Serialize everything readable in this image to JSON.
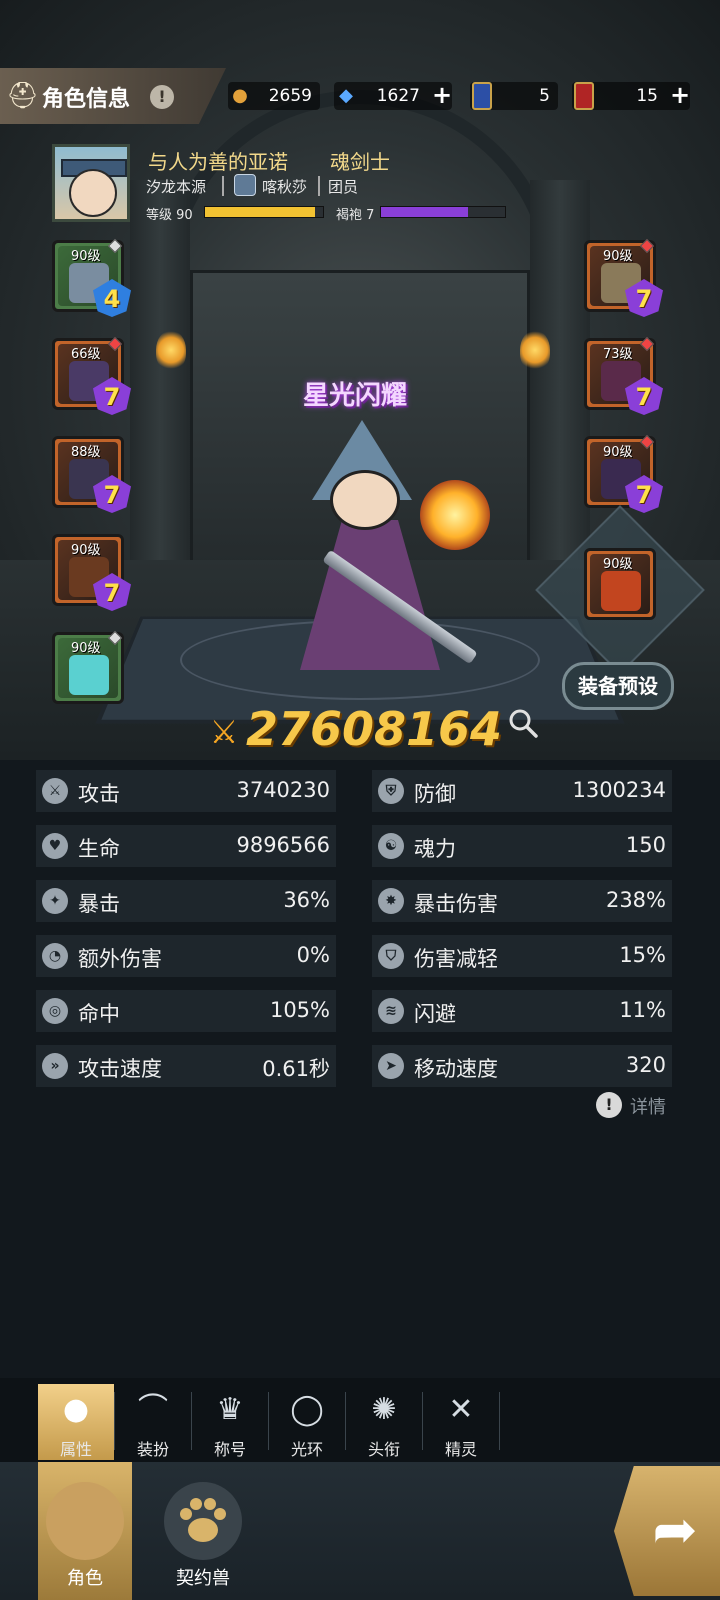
{
  "header": {
    "title": "角色信息",
    "title_icon": "helmet-icon",
    "info_icon": "exclamation-icon",
    "currencies": [
      {
        "name": "coin",
        "icon": "gold-coin-icon",
        "value": "2659",
        "plus": false
      },
      {
        "name": "crystal",
        "icon": "blue-crystal-icon",
        "value": "1627",
        "plus": true
      },
      {
        "name": "ticket-blue",
        "icon": "blue-card-icon",
        "value": "5",
        "plus": false
      },
      {
        "name": "ticket-red",
        "icon": "red-card-icon",
        "value": "15",
        "plus": true
      }
    ],
    "plus_glyph": "+"
  },
  "profile": {
    "name": "与人为善的亚诺",
    "class": "魂剑士",
    "server": "汐龙本源",
    "guild": "喀秋莎",
    "rank": "团员",
    "level_label": "等级 90",
    "level_progress": 0.93,
    "robe_label": "褐袍 7",
    "robe_progress": 0.7
  },
  "equipment": {
    "left": [
      {
        "level": "90级",
        "rarity": "green",
        "gem": "4",
        "gem_color": "blue"
      },
      {
        "level": "66级",
        "rarity": "orange",
        "gem": "7",
        "gem_color": "purple"
      },
      {
        "level": "88级",
        "rarity": "orange",
        "gem": "7",
        "gem_color": "purple"
      },
      {
        "level": "90级",
        "rarity": "orange",
        "gem": "7",
        "gem_color": "purple"
      },
      {
        "level": "90级",
        "rarity": "green",
        "gem": "",
        "gem_color": ""
      }
    ],
    "right": [
      {
        "level": "90级",
        "rarity": "orange",
        "gem": "7",
        "gem_color": "purple"
      },
      {
        "level": "73级",
        "rarity": "orange",
        "gem": "7",
        "gem_color": "purple"
      },
      {
        "level": "90级",
        "rarity": "orange",
        "gem": "7",
        "gem_color": "purple"
      }
    ],
    "special": {
      "level": "90级",
      "rarity": "orange"
    }
  },
  "hero": {
    "title_badge": "星光闪耀"
  },
  "preset_button": "装备预设",
  "combat_power": "27608164",
  "stats": [
    {
      "name": "攻击",
      "value": "3740230",
      "icon": "sword-icon"
    },
    {
      "name": "防御",
      "value": "1300234",
      "icon": "shield-icon"
    },
    {
      "name": "生命",
      "value": "9896566",
      "icon": "heart-icon"
    },
    {
      "name": "魂力",
      "value": "150",
      "icon": "soul-icon"
    },
    {
      "name": "暴击",
      "value": "36%",
      "icon": "crit-icon"
    },
    {
      "name": "暴击伤害",
      "value": "238%",
      "icon": "burst-icon"
    },
    {
      "name": "额外伤害",
      "value": "0%",
      "icon": "extra-damage-icon"
    },
    {
      "name": "伤害减轻",
      "value": "15%",
      "icon": "damage-reduce-icon"
    },
    {
      "name": "命中",
      "value": "105%",
      "icon": "target-icon"
    },
    {
      "name": "闪避",
      "value": "11%",
      "icon": "dodge-icon"
    },
    {
      "name": "攻击速度",
      "value": "0.61秒",
      "icon": "attack-speed-icon"
    },
    {
      "name": "移动速度",
      "value": "320",
      "icon": "move-speed-icon"
    }
  ],
  "details_label": "详情",
  "sub_tabs": [
    {
      "label": "属性",
      "icon": "person-icon",
      "active": true
    },
    {
      "label": "装扮",
      "icon": "hanger-icon",
      "active": false
    },
    {
      "label": "称号",
      "icon": "crown-icon",
      "active": false
    },
    {
      "label": "光环",
      "icon": "halo-icon",
      "active": false
    },
    {
      "label": "头衔",
      "icon": "emblem-icon",
      "active": false
    },
    {
      "label": "精灵",
      "icon": "spirit-icon",
      "active": false
    }
  ],
  "bottom_nav": [
    {
      "label": "角色",
      "icon": "helmet-icon",
      "active": true
    },
    {
      "label": "契约兽",
      "icon": "paw-icon",
      "active": false
    }
  ],
  "colors": {
    "gold": "#f7c84a",
    "level_bar": "#f2c232",
    "robe_bar": "#8a3fd8",
    "gem_purple": "#8a3fd8",
    "gem_blue": "#2f7fe0"
  }
}
